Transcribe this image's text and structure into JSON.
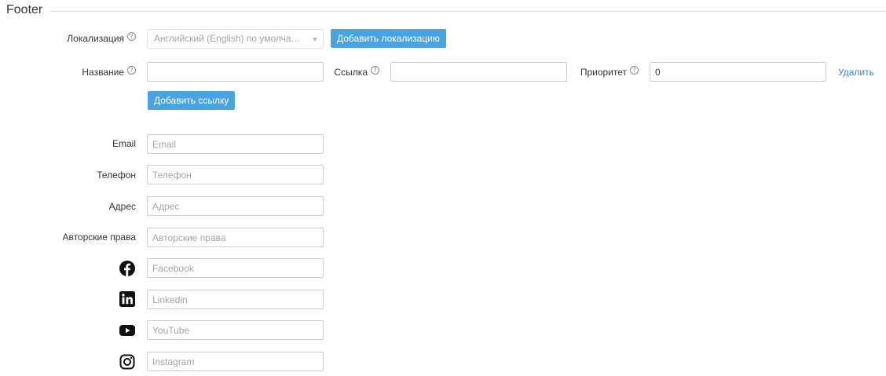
{
  "section": {
    "title": "Footer"
  },
  "localization": {
    "label": "Локализация",
    "help": "?",
    "selected": "Английский (English) по умолчанию",
    "add_button": "Добавить локализацию"
  },
  "link_row": {
    "name_label": "Название",
    "url_label": "Ссылка",
    "priority_label": "Приоритет",
    "priority_value": "0",
    "delete_label": "Удалить",
    "add_link_button": "Добавить ссылку"
  },
  "contacts": {
    "email": {
      "label": "Email",
      "placeholder": "Email"
    },
    "phone": {
      "label": "Телефон",
      "placeholder": "Телефон"
    },
    "address": {
      "label": "Адрес",
      "placeholder": "Адрес"
    },
    "copyright": {
      "label": "Авторские права",
      "placeholder": "Авторские права"
    }
  },
  "social": {
    "facebook": {
      "icon": "facebook-icon",
      "placeholder": "Facebook"
    },
    "linkedin": {
      "icon": "linkedin-icon",
      "placeholder": "Linkedin"
    },
    "youtube": {
      "icon": "youtube-icon",
      "placeholder": "YouTube"
    },
    "instagram": {
      "icon": "instagram-icon",
      "placeholder": "Instagram"
    }
  },
  "colors": {
    "accent": "#49a3df",
    "link": "#2a8ccf",
    "border": "#cccccc"
  }
}
